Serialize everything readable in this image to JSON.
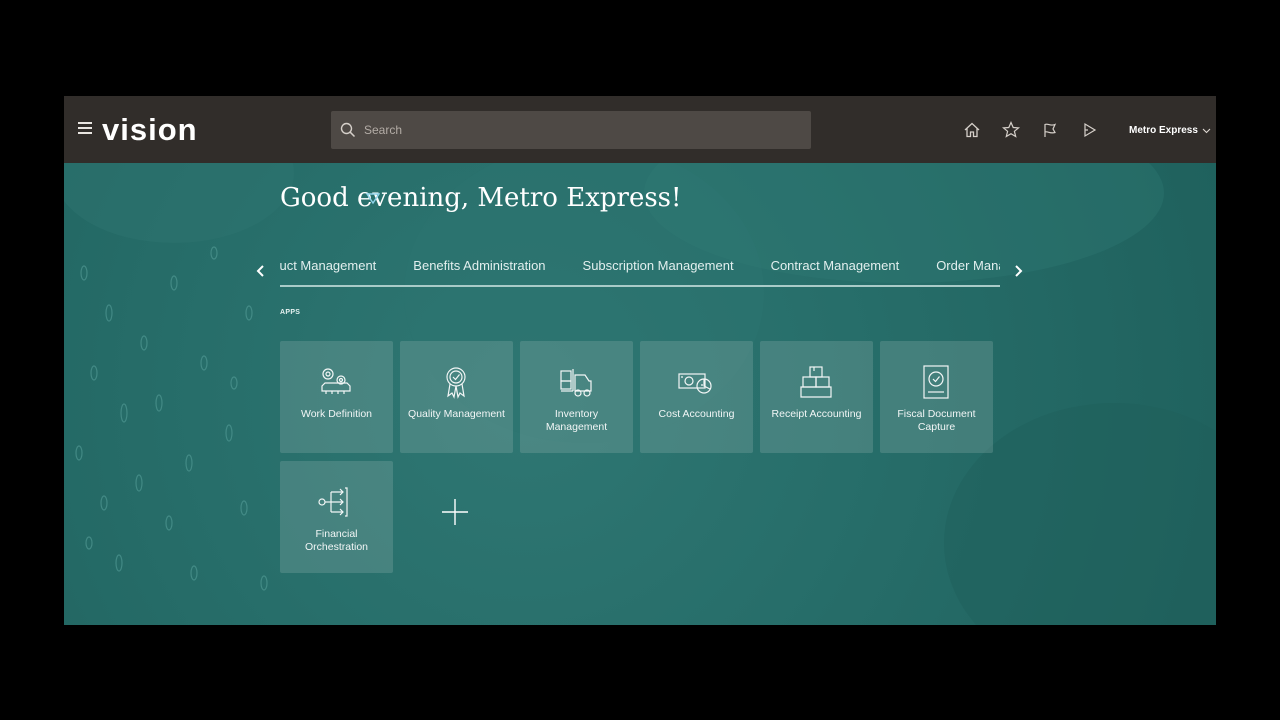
{
  "header": {
    "logo": "vision",
    "search_placeholder": "Search",
    "user_name": "Metro Express",
    "icons": [
      "home-icon",
      "favorites-star-icon",
      "watchlist-flag-icon",
      "notifications-bell-icon"
    ]
  },
  "main": {
    "greeting": "Good evening, Metro Express!",
    "tabs": [
      {
        "label": "Product Management"
      },
      {
        "label": "Benefits Administration"
      },
      {
        "label": "Subscription Management"
      },
      {
        "label": "Contract Management"
      },
      {
        "label": "Order Management"
      }
    ],
    "apps_label": "APPS",
    "apps": [
      {
        "label": "Work Definition",
        "icon": "work-definition-icon"
      },
      {
        "label": "Quality Management",
        "icon": "quality-award-icon"
      },
      {
        "label": "Inventory Management",
        "icon": "forklift-icon"
      },
      {
        "label": "Cost Accounting",
        "icon": "cost-accounting-icon"
      },
      {
        "label": "Receipt Accounting",
        "icon": "receipt-box-icon"
      },
      {
        "label": "Fiscal Document Capture",
        "icon": "fiscal-document-icon"
      },
      {
        "label": "Financial Orchestration",
        "icon": "orchestration-icon"
      }
    ]
  },
  "colors": {
    "header_bg": "#312d2a",
    "main_bg": "#276e6a",
    "tile_bg": "#5a8a87"
  }
}
